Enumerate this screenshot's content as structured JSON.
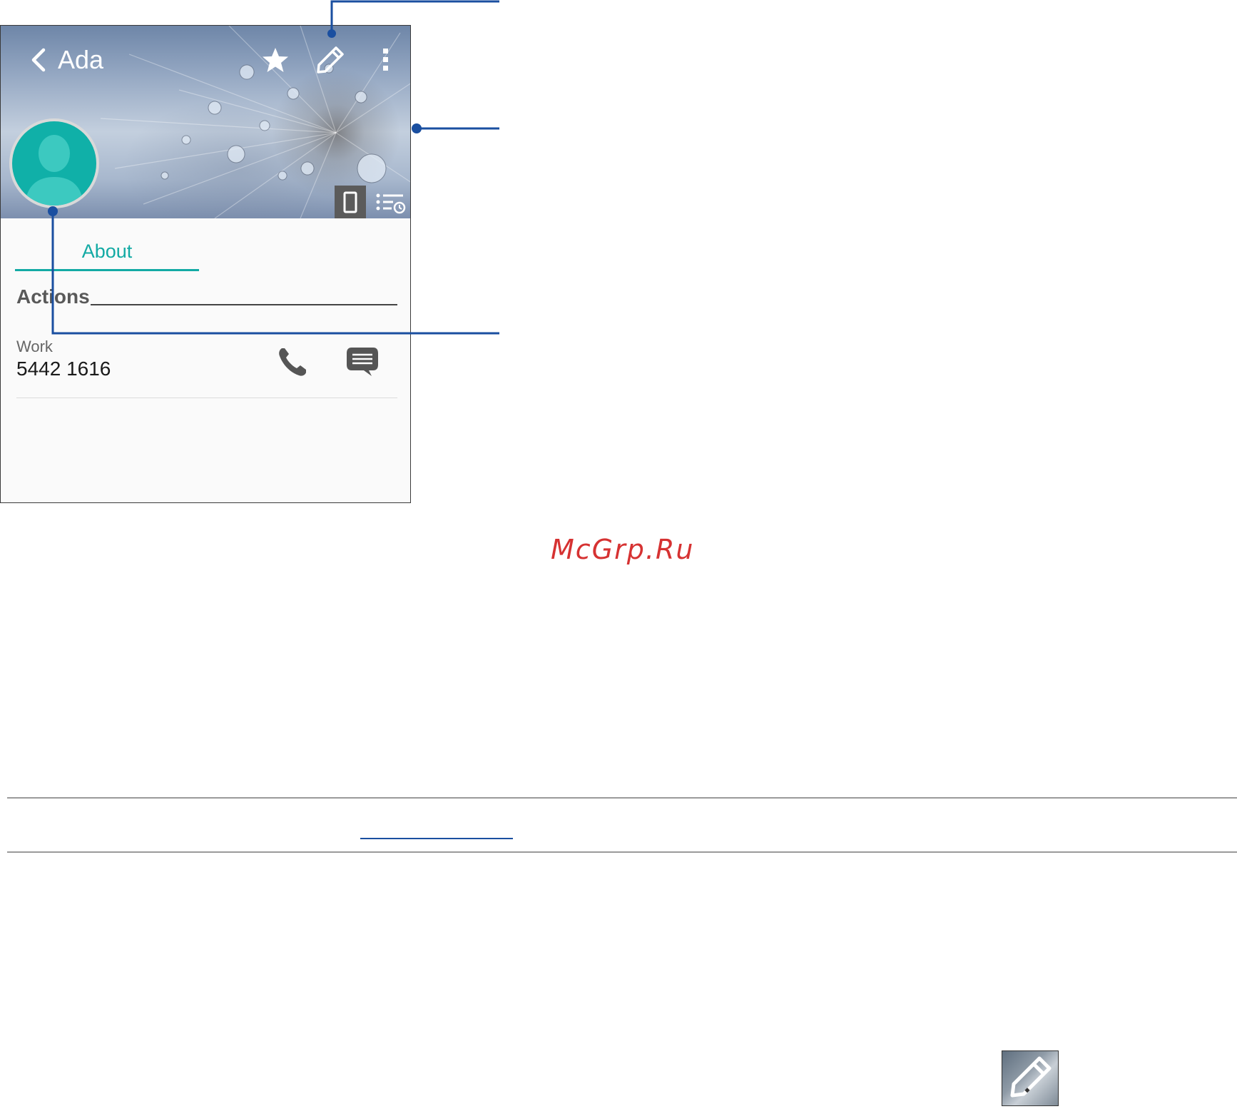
{
  "contact": {
    "name": "Ada",
    "tabs": [
      {
        "label": "About"
      }
    ],
    "section_title": "Actions",
    "phone": {
      "type": "Work",
      "number": "5442 1616"
    }
  },
  "toolbar": {
    "icons": [
      "back-chevron-icon",
      "star-icon",
      "pencil-icon",
      "overflow-menu-icon"
    ]
  },
  "header_buttons": [
    "phone-icon",
    "call-history-icon"
  ],
  "watermark": "McGrp.Ru",
  "colors": {
    "accent": "#13aaa4",
    "avatar": "#10b0a8",
    "callout": "#1a4fa0",
    "watermark": "#d63232"
  }
}
